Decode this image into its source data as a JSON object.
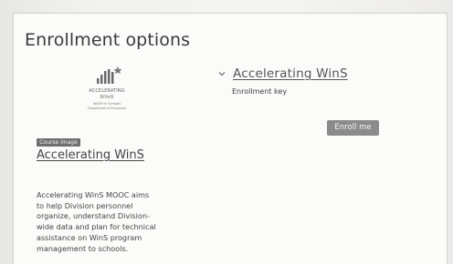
{
  "page": {
    "title": "Enrollment options"
  },
  "course": {
    "title": "Accelerating WinS",
    "image_label": "Course image",
    "summary_lines": [
      "Accelerating WinS MOOC aims",
      "to help Division personnel",
      "organize, understand Division-",
      "wide data and plan for technical",
      "assistance on WinS program",
      "management to schools."
    ]
  },
  "enrollment": {
    "title": "Accelerating WinS",
    "key_label": "Enrollment key",
    "button_label": "Enroll me"
  },
  "logo": {
    "line1": "ACCELERATING",
    "line2": "WinS",
    "line3": "WASH in Schools",
    "line4": "Department of Education"
  },
  "icons": {
    "section_toggle": "chevron-down-icon",
    "logo": "accelerating-wins-logo"
  },
  "colors": {
    "background": "#fbfbf9",
    "button": "#8b8b8b",
    "text": "#333333"
  }
}
